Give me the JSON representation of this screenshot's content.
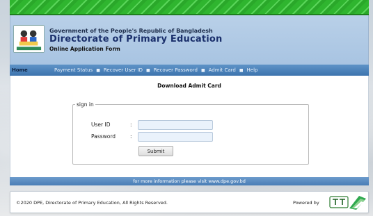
{
  "header": {
    "government": "Government of the People's Republic of Bangladesh",
    "directorate": "Directorate of Primary Education",
    "form_title": "Online Application Form"
  },
  "nav": {
    "home": "Home",
    "items": [
      "Payment Status",
      "Recover User ID",
      "Recover Password",
      "Admit Card",
      "Help"
    ],
    "separator": "■"
  },
  "main": {
    "title": "Download Admit Card",
    "legend": "sign in",
    "user_id_label": "User ID",
    "password_label": "Password",
    "colon": ":",
    "user_id_value": "",
    "password_value": "",
    "submit_label": "Submit"
  },
  "info_bar": "for more information please visit www.dpe.gov.bd",
  "footer": {
    "copyright": "©2020 DPE, Directorate of Primary Education, All Rights Reserved.",
    "powered_by": "Powered by",
    "logo_name": "teletalk-icon"
  },
  "colors": {
    "stripe_green": "#2fb52f",
    "header_blue": "#a8c4e2",
    "nav_blue": "#3d74ae",
    "title_navy": "#1a2f6b"
  }
}
